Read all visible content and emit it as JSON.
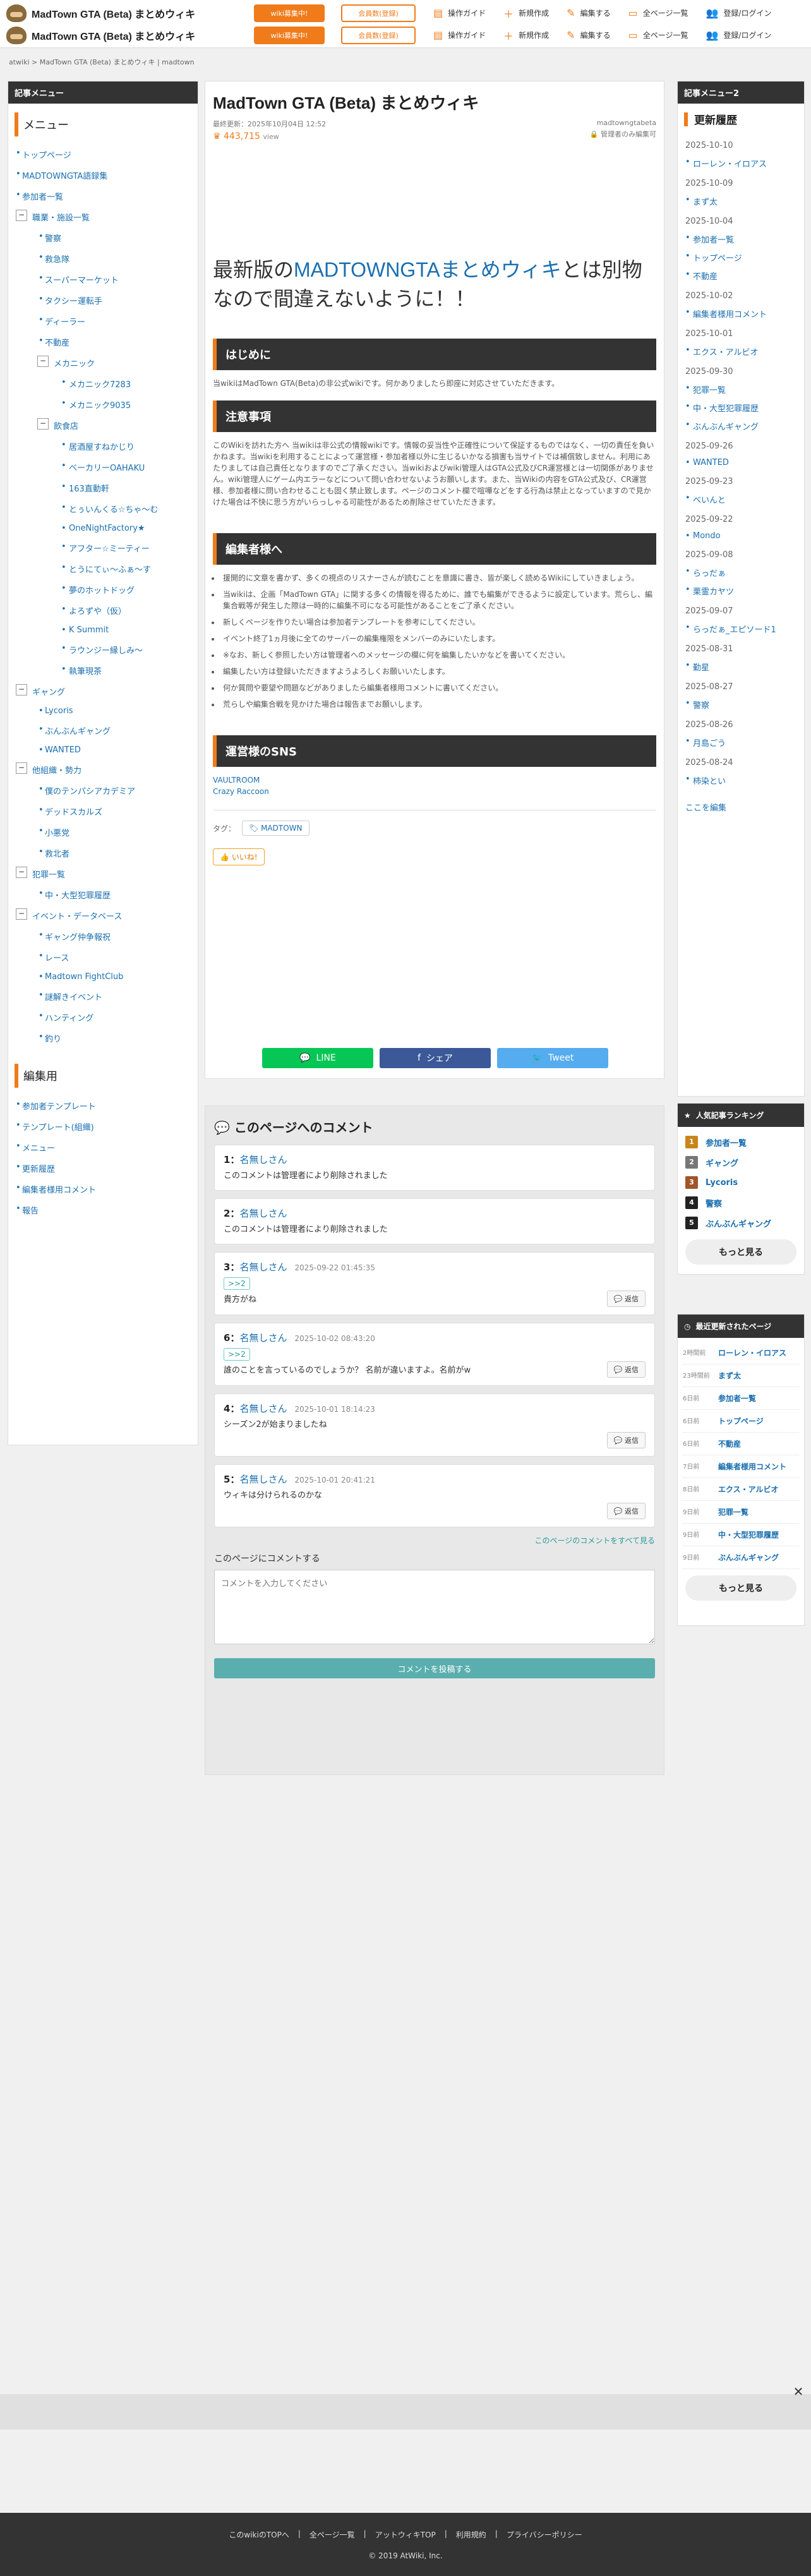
{
  "header": {
    "site_title": "MadTown GTA (Beta) まとめウィキ",
    "wiki_btn": "wiki募集中!",
    "member_btn": "会員数(登録)",
    "nav": [
      {
        "label": "操作ガイド",
        "icon": "book-icon"
      },
      {
        "label": "新規作成",
        "icon": "plus-icon"
      },
      {
        "label": "編集する",
        "icon": "pencil-icon"
      },
      {
        "label": "全ページ一覧",
        "icon": "pages-icon"
      },
      {
        "label": "登録/ログイン",
        "icon": "user-icon"
      }
    ]
  },
  "breadcrumb": "atwiki > MadTown GTA (Beta) まとめウィキ | madtown",
  "sidebar": {
    "head": "記事メニュー",
    "menu_title": "メニュー",
    "items": [
      "トップページ",
      "MADTOWNGTA語録集",
      "参加者一覧",
      "職業・施設一覧",
      "警察",
      "救急隊",
      "スーパーマーケット",
      "タクシー運転手",
      "ディーラー",
      "不動産",
      "メカニック",
      "メカニック7283",
      "メカニック9035",
      "飲食店",
      "居酒屋すねかじり",
      "ベーカリーOAHAKU",
      "163直動軒",
      "とぅいんくる☆ちゃ〜む",
      "OneNightFactory★",
      "アフター☆ミーティー",
      "とうにてぃ〜ふぁ〜す",
      "夢のホットドッグ",
      "よろずや（仮）",
      "K Summit",
      "ラウンジー縁しみ〜",
      "執筆現茶",
      "ギャング",
      "Lycoris",
      "ぶんぶんギャング",
      "WANTED",
      "他組織・勢力",
      "僕のテンパシアカデミア",
      "デッドスカルズ",
      "小悪党",
      "救北者",
      "犯罪一覧",
      "中・大型犯罪履歴",
      "イベント・データベース",
      "ギャング仲争報祝",
      "レース",
      "Madtown FightClub",
      "謎解きイベント",
      "ハンティング",
      "釣り"
    ],
    "edit_title": "編集用",
    "edit_items": [
      "参加者テンプレート",
      "テンプレート(組織)",
      "メニュー",
      "更新履歴",
      "編集者様用コメント",
      "報告"
    ]
  },
  "main": {
    "title": "MadTown GTA (Beta) まとめウィキ",
    "updated": "最終更新：2025年10月04日 12:52",
    "author": "madtowngtabeta",
    "lock_label": "管理者のみ編集可",
    "views": "443,715",
    "views_unit": "view",
    "big_text_a": "最新版の",
    "big_text_link": "MADTOWNGTAまとめウィキ",
    "big_text_b": "とは別物なので間違えないように！！",
    "sec1": "はじめに",
    "sec1_p": "当wikiはMadTown GTA(Beta)の非公式wikiです。何かありましたら即座に対応させていただきます。",
    "sec2": "注意事項",
    "sec2_p": "このWikiを訪れた方へ 当wikiは非公式の情報wikiです。情報の妥当性や正確性について保証するものではなく、一切の責任を負いかねます。当wikiを利用することによって運営様・参加者様以外に生じるいかなる損害も当サイトでは補償致しません。利用にあたりましては自己責任となりますのでご了承ください。当wikiおよびwiki管理人はGTA公式及びCR運営様とは一切関係がありません。wiki管理人にゲーム内エラーなどについて問い合わせないようお願いします。また、当Wikiの内容をGTA公式及び、CR運営様、参加者様に問い合わせることも固く禁止致します。ページのコメント欄で喧嘩などをする行為は禁止となっていますので見かけた場合は不快に思う方がいらっしゃる可能性があるため削除させていただきます。",
    "sec3": "編集者様へ",
    "sec3_items": [
      "援開的に文章を書かず、多くの視点のリスナーさんが読むことを意識に書き、皆が楽しく読めるWikiにしていきましょう。",
      "当wikiは、企画「MadTown GTA」に関する多くの情報を得るために、誰でも編集ができるように設定しています。荒らし、編集合戦等が発生した際は一時的に編集不可になる可能性があることをご了承ください。",
      "新しくページを作りたい場合は参加者テンプレートを参考にしてください。",
      "イベント終了1ヵ月後に全てのサーバーの編集権限をメンバーのみにいたします。",
      "※なお、新しく参照したい方は管理者へのメッセージの欄に何を編集したいかなどを書いてください。",
      "編集したい方は登録いただきますようよろしくお願いいたします。",
      "何か質問や要望や問題などがありましたら編集者様用コメントに書いてください。",
      "荒らしや編集合戦を見かけた場合は報告までお願いします。"
    ],
    "sec4": "運営様のSNS",
    "sns": [
      "VAULTROOM",
      "Crazy Raccoon"
    ],
    "tag_label": "タグ：",
    "tag": "MADTOWN",
    "like": "いいね!",
    "share": {
      "line": "LINE",
      "fb": "シェア",
      "tw": "Tweet"
    }
  },
  "comments": {
    "title": "このページへのコメント",
    "items": [
      {
        "num": "1：",
        "name": "名無しさん",
        "date": "",
        "anchor": "",
        "text": "このコメントは管理者により削除されました",
        "reply": ""
      },
      {
        "num": "2：",
        "name": "名無しさん",
        "date": "",
        "anchor": "",
        "text": "このコメントは管理者により削除されました",
        "reply": ""
      },
      {
        "num": "3：",
        "name": "名無しさん",
        "date": "2025-09-22 01:45:35",
        "anchor": ">>2",
        "text": "貴方がね",
        "reply": "返信"
      },
      {
        "num": "6：",
        "name": "名無しさん",
        "date": "2025-10-02 08:43:20",
        "anchor": ">>2",
        "text": "誰のことを言っているのでしょうか？ 名前が違いますよ。名前がw",
        "reply": "返信"
      },
      {
        "num": "4：",
        "name": "名無しさん",
        "date": "2025-10-01 18:14:23",
        "anchor": "",
        "text": "シーズン2が始まりましたね",
        "reply": "返信"
      },
      {
        "num": "5：",
        "name": "名無しさん",
        "date": "2025-10-01 20:41:21",
        "anchor": "",
        "text": "ウィキは分けられるのかな",
        "reply": "返信"
      }
    ],
    "all_link": "このページのコメントをすべて見る",
    "form_label": "このページにコメントする",
    "placeholder": "コメントを入力してください",
    "post_btn": "コメントを投稿する"
  },
  "right": {
    "head": "記事メニュー2",
    "history_title": "更新履歴",
    "history": [
      {
        "d": "2025-10-10",
        "items": [
          "ローレン・イロアス"
        ]
      },
      {
        "d": "2025-10-09",
        "items": [
          "まず太"
        ]
      },
      {
        "d": "2025-10-04",
        "items": [
          "参加者一覧",
          "トップページ",
          "不動産"
        ]
      },
      {
        "d": "2025-10-02",
        "items": [
          "編集者様用コメント"
        ]
      },
      {
        "d": "2025-10-01",
        "items": [
          "エクス・アルビオ"
        ]
      },
      {
        "d": "2025-09-30",
        "items": [
          "犯罪一覧",
          "中・大型犯罪履歴",
          "ぶんぶんギャング"
        ]
      },
      {
        "d": "2025-09-26",
        "items": [
          "WANTED"
        ]
      },
      {
        "d": "2025-09-23",
        "items": [
          "べいんと"
        ]
      },
      {
        "d": "2025-09-22",
        "items": [
          "Mondo"
        ]
      },
      {
        "d": "2025-09-08",
        "items": [
          "らっだぁ",
          "栗霊カヤツ"
        ]
      },
      {
        "d": "2025-09-07",
        "items": [
          "らっだぁ_エピソード1"
        ]
      },
      {
        "d": "2025-08-31",
        "items": [
          "勤星"
        ]
      },
      {
        "d": "2025-08-27",
        "items": [
          "警察"
        ]
      },
      {
        "d": "2025-08-26",
        "items": [
          "月島ごう"
        ]
      },
      {
        "d": "2025-08-24",
        "items": [
          "柿染とい"
        ]
      }
    ],
    "history_more": "ここを編集",
    "ranking_title": "人気記事ランキング",
    "ranking": [
      "参加者一覧",
      "ギャング",
      "Lycoris",
      "警察",
      "ぶんぶんギャング"
    ],
    "ranking_colors": [
      "#c8861a",
      "#777777",
      "#a0552a",
      "#222222",
      "#222222"
    ],
    "more": "もっと見る",
    "recent_title": "最近更新されたページ",
    "recent": [
      {
        "t": "2時間前",
        "p": "ローレン・イロアス"
      },
      {
        "t": "23時間前",
        "p": "まず太"
      },
      {
        "t": "6日前",
        "p": "参加者一覧"
      },
      {
        "t": "6日前",
        "p": "トップページ"
      },
      {
        "t": "6日前",
        "p": "不動産"
      },
      {
        "t": "7日前",
        "p": "編集者様用コメント"
      },
      {
        "t": "8日前",
        "p": "エクス・アルビオ"
      },
      {
        "t": "9日前",
        "p": "犯罪一覧"
      },
      {
        "t": "9日前",
        "p": "中・大型犯罪履歴"
      },
      {
        "t": "9日前",
        "p": "ぶんぶんギャング"
      }
    ]
  },
  "footer": {
    "links": [
      "このwikiのTOPへ",
      "全ページ一覧",
      "アットウィキTOP",
      "利用規約",
      "プライバシーポリシー"
    ],
    "copy": "2019 AtWiki, Inc."
  }
}
